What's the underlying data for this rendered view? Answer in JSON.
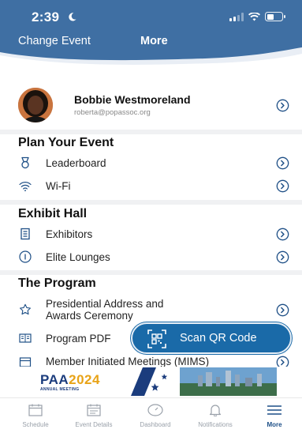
{
  "status_bar": {
    "time": "2:39"
  },
  "nav": {
    "change_event": "Change Event",
    "title": "More"
  },
  "profile": {
    "name": "Bobbie Westmoreland",
    "email": "roberta@popassoc.org"
  },
  "sections": {
    "plan": {
      "title": "Plan Your Event",
      "leaderboard": "Leaderboard",
      "wifi": "Wi-Fi"
    },
    "exhibit": {
      "title": "Exhibit Hall",
      "exhibitors": "Exhibitors",
      "lounges": "Elite Lounges"
    },
    "program": {
      "title": "The Program",
      "presidential_line1": "Presidential Address and",
      "presidential_line2": "Awards Ceremony",
      "program_pdf": "Program PDF",
      "member_meetings": "Member Initiated Meetings (MIMS)"
    }
  },
  "scan_button": {
    "label": "Scan QR Code"
  },
  "banner": {
    "logo_left": "PA",
    "logo_a": "A",
    "logo_year": "2024",
    "sub": "ANNUAL MEETING"
  },
  "tabs": {
    "schedule": "Schedule",
    "event_details": "Event Details",
    "dashboard": "Dashboard",
    "notifications": "Notifications",
    "more": "More"
  },
  "colors": {
    "header": "#3f6fa3",
    "accent": "#1a6aa8",
    "active_tab": "#1d4f87"
  },
  "battery_level": 0.45,
  "icons": [
    "moon-icon",
    "signal-icon",
    "wifi-icon",
    "battery-icon",
    "chevron-right-icon",
    "leaderboard-icon",
    "wifi-icon",
    "exhibitors-icon",
    "info-icon",
    "star-icon",
    "book-icon",
    "calendar-icon",
    "qr-code-icon",
    "menu-icon"
  ]
}
